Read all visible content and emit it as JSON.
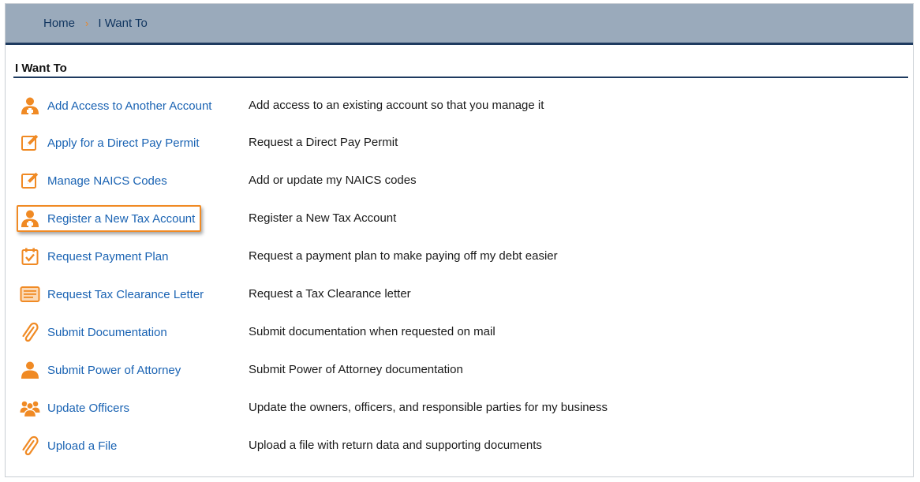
{
  "breadcrumb": {
    "home": "Home",
    "separator": "›",
    "current": "I Want To"
  },
  "section": {
    "title": "I Want To"
  },
  "colors": {
    "accent": "#f08a24",
    "link": "#1a63b3",
    "header_bg": "#9aaabb",
    "rule": "#1e3a5f"
  },
  "actions": [
    {
      "label": "Add Access to Another Account",
      "description": "Add access to an existing account so that you manage it",
      "icon": "add-user-icon"
    },
    {
      "label": "Apply for a Direct Pay Permit",
      "description": "Request a Direct Pay Permit",
      "icon": "edit-form-icon"
    },
    {
      "label": "Manage NAICS Codes",
      "description": "Add or update my NAICS codes",
      "icon": "edit-form-icon"
    },
    {
      "label": "Register a New Tax Account",
      "description": "Register a New Tax Account",
      "icon": "add-user-icon",
      "highlighted": true
    },
    {
      "label": "Request Payment Plan",
      "description": "Request a payment plan to make paying off my debt easier",
      "icon": "calendar-check-icon"
    },
    {
      "label": "Request Tax Clearance Letter",
      "description": "Request a Tax Clearance letter",
      "icon": "letter-icon"
    },
    {
      "label": "Submit Documentation",
      "description": "Submit documentation when requested on mail",
      "icon": "paperclip-icon"
    },
    {
      "label": "Submit Power of Attorney",
      "description": "Submit Power of Attorney documentation",
      "icon": "person-icon"
    },
    {
      "label": "Update Officers",
      "description": "Update the owners, officers, and responsible parties for my business",
      "icon": "group-icon"
    },
    {
      "label": "Upload a File",
      "description": "Upload a file with return data and supporting documents",
      "icon": "paperclip-icon"
    }
  ]
}
